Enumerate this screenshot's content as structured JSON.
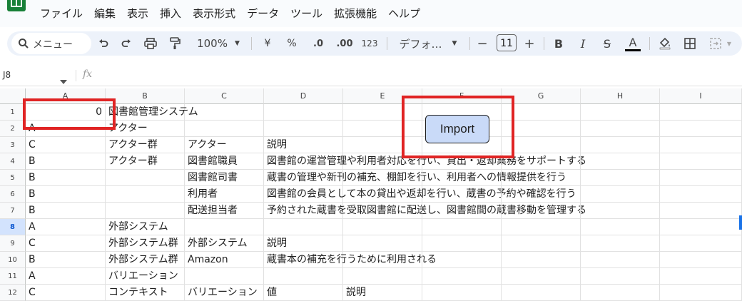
{
  "menu": [
    "ファイル",
    "編集",
    "表示",
    "挿入",
    "表示形式",
    "データ",
    "ツール",
    "拡張機能",
    "ヘルプ"
  ],
  "toolbar": {
    "search_label": "メニュー",
    "zoom": "100%",
    "currency": "¥",
    "percent": "%",
    "dec_decrease": ".0",
    "dec_increase": ".00",
    "number_format": "123",
    "font": "デフォ…",
    "font_size": "11",
    "minus": "−",
    "plus": "+",
    "bold": "B",
    "italic": "I",
    "strike": "S",
    "text_color": "A"
  },
  "formula_bar": {
    "cell_ref": "J8",
    "fx": "fx"
  },
  "columns": [
    "A",
    "B",
    "C",
    "D",
    "E",
    "F",
    "G",
    "H",
    "I"
  ],
  "rows": [
    {
      "num": "1",
      "a": "0",
      "b": "図書館管理システム",
      "c": "",
      "d": "",
      "e": ""
    },
    {
      "num": "2",
      "a": "A",
      "b": "アクター",
      "c": "",
      "d": "",
      "e": ""
    },
    {
      "num": "3",
      "a": "C",
      "b": "アクター群",
      "c": "アクター",
      "d": "説明",
      "e": ""
    },
    {
      "num": "4",
      "a": "B",
      "b": "アクター群",
      "c": "図書館職員",
      "d": "図書館の運営管理や利用者対応を行い、貸出・返却業務をサポートする",
      "e": ""
    },
    {
      "num": "5",
      "a": "B",
      "b": "",
      "c": "図書館司書",
      "d": "蔵書の管理や新刊の補充、棚卸を行い、利用者への情報提供を行う",
      "e": ""
    },
    {
      "num": "6",
      "a": "B",
      "b": "",
      "c": "利用者",
      "d": "図書館の会員として本の貸出や返却を行い、蔵書の予約や確認を行う",
      "e": ""
    },
    {
      "num": "7",
      "a": "B",
      "b": "",
      "c": "配送担当者",
      "d": "予約された蔵書を受取図書館に配送し、図書館間の蔵書移動を管理する",
      "e": ""
    },
    {
      "num": "8",
      "a": "A",
      "b": "外部システム",
      "c": "",
      "d": "",
      "e": ""
    },
    {
      "num": "9",
      "a": "C",
      "b": "外部システム群",
      "c": "外部システム",
      "d": "説明",
      "e": ""
    },
    {
      "num": "10",
      "a": "B",
      "b": "外部システム群",
      "c": "Amazon",
      "d": "蔵書本の補充を行うために利用される",
      "e": ""
    },
    {
      "num": "11",
      "a": "A",
      "b": "バリエーション",
      "c": "",
      "d": "",
      "e": ""
    },
    {
      "num": "12",
      "a": "C",
      "b": "コンテキスト",
      "c": "バリエーション",
      "d": "値",
      "e": "説明"
    }
  ],
  "import_button": "Import",
  "colors": {
    "accent": "#0b57d0",
    "highlight": "#e02424",
    "button": "#c9daf8"
  }
}
